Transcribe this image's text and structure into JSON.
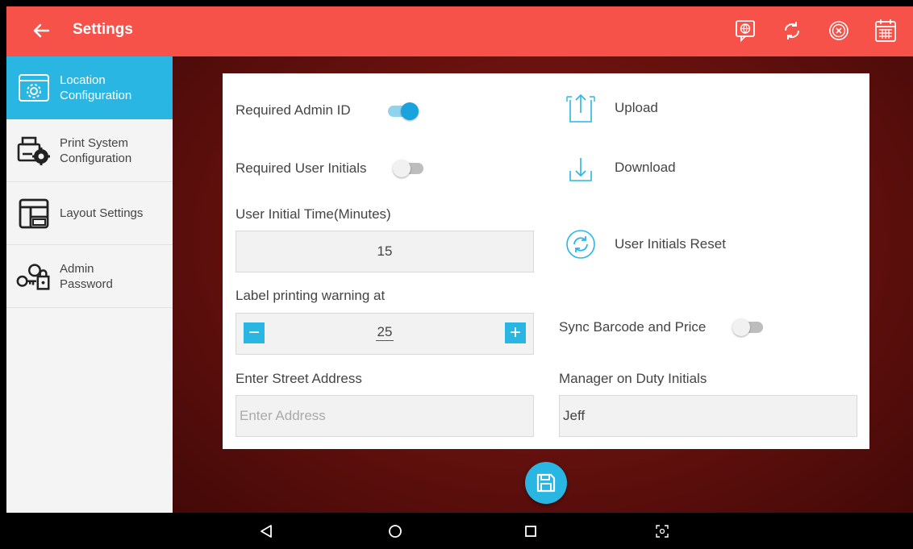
{
  "appbar": {
    "title": "Settings",
    "bg_color": "#f65249",
    "actions": [
      "language-icon",
      "sync-icon",
      "close-circle-icon",
      "calendar-icon"
    ]
  },
  "sidebar": {
    "accent": "#29b6e3",
    "items": [
      {
        "label": "Location\nConfiguration",
        "icon": "location-config-icon",
        "active": true
      },
      {
        "label": "Print System\nConfiguration",
        "icon": "print-config-icon",
        "active": false
      },
      {
        "label": "Layout Settings",
        "icon": "layout-icon",
        "active": false
      },
      {
        "label": "Admin\nPassword",
        "icon": "admin-password-icon",
        "active": false
      }
    ]
  },
  "settings": {
    "required_admin_id": {
      "label": "Required Admin ID",
      "on": true
    },
    "required_user_initials": {
      "label": "Required User Initials",
      "on": false
    },
    "user_initial_time": {
      "label": "User Initial Time(Minutes)",
      "value": "15"
    },
    "label_warning": {
      "label": "Label printing warning at",
      "value": "25",
      "minus": "−",
      "plus": "+"
    },
    "street_address": {
      "label": "Enter Street Address",
      "placeholder": "Enter Address",
      "value": ""
    },
    "upload": {
      "label": "Upload"
    },
    "download": {
      "label": "Download"
    },
    "user_initials_reset": {
      "label": "User Initials Reset"
    },
    "sync_barcode": {
      "label": "Sync Barcode and Price",
      "on": false
    },
    "manager_initials": {
      "label": "Manager on Duty Initials",
      "value": "Jeff"
    }
  },
  "save_button": {
    "icon": "save-icon"
  },
  "navbar": {
    "buttons": [
      "back-nav-icon",
      "home-nav-icon",
      "recents-nav-icon",
      "screenshot-nav-icon"
    ]
  }
}
